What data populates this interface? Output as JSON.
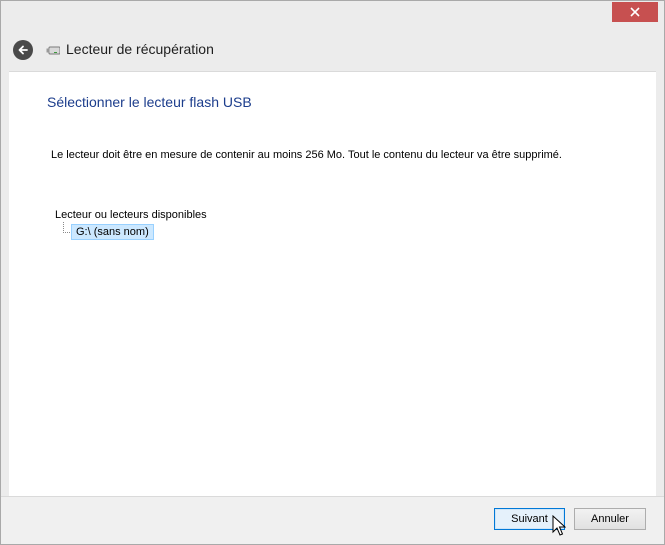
{
  "window": {
    "title": "Lecteur de récupération",
    "close_icon": "close-icon"
  },
  "header": {
    "back_icon": "back-arrow-icon",
    "app_icon": "usb-drive-icon"
  },
  "main": {
    "heading": "Sélectionner le lecteur flash USB",
    "instructions": "Le lecteur doit être en mesure de contenir au moins 256 Mo. Tout le contenu du lecteur va être supprimé.",
    "drives_label": "Lecteur ou lecteurs disponibles",
    "drives": [
      {
        "label": "G:\\ (sans nom)",
        "selected": true
      }
    ]
  },
  "footer": {
    "next_label": "Suivant",
    "cancel_label": "Annuler"
  },
  "colors": {
    "heading": "#1c3d8c",
    "close_button": "#c75050",
    "selection": "#cce8ff",
    "default_button_border": "#0078d7"
  }
}
